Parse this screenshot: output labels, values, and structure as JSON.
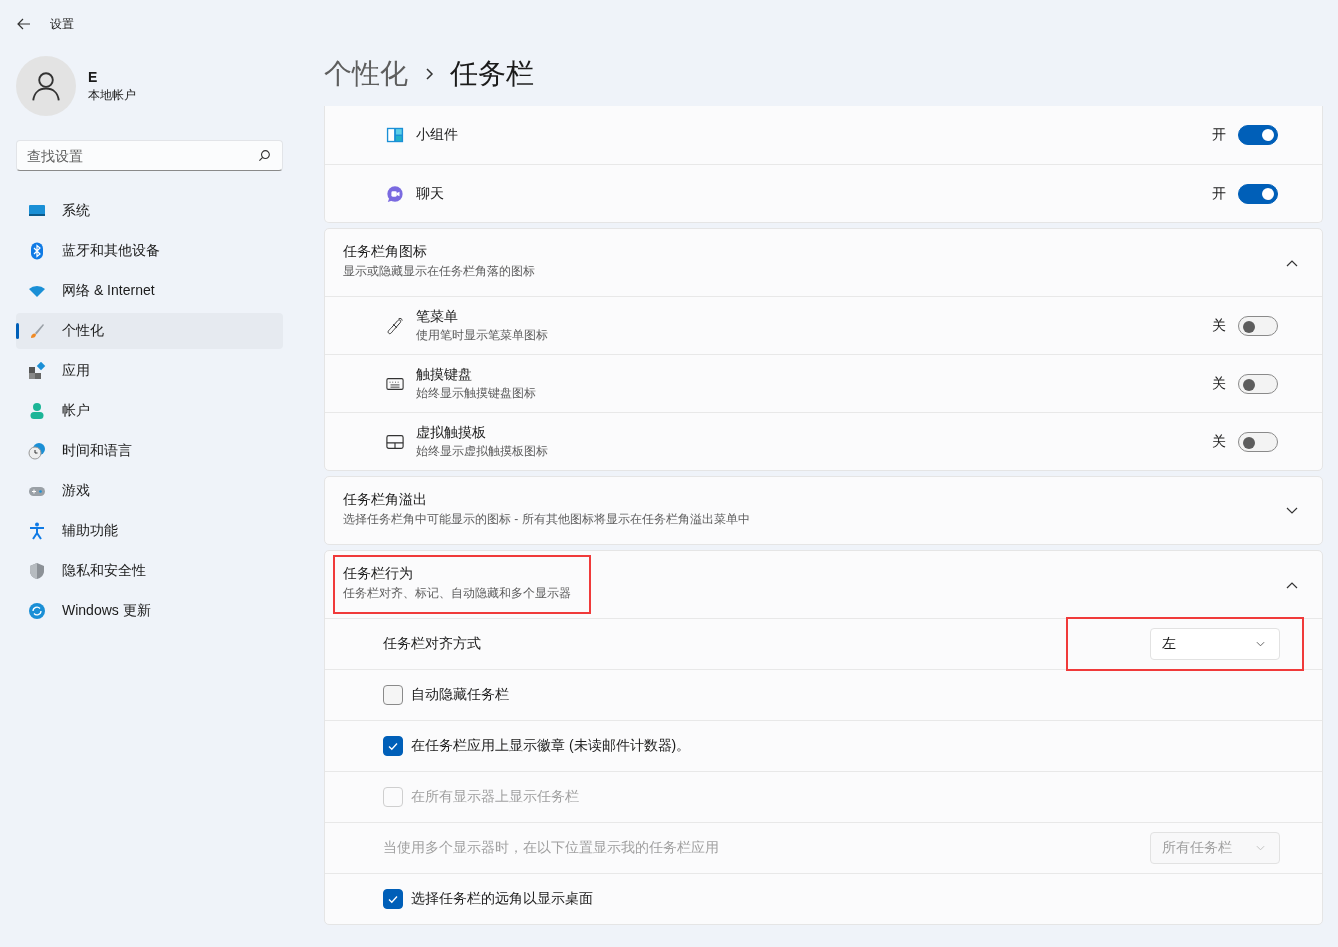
{
  "window": {
    "title": "设置"
  },
  "user": {
    "name": "E",
    "account": "本地帐户"
  },
  "search": {
    "placeholder": "查找设置"
  },
  "nav": [
    {
      "label": "系统",
      "selected": false
    },
    {
      "label": "蓝牙和其他设备",
      "selected": false
    },
    {
      "label": "网络 & Internet",
      "selected": false
    },
    {
      "label": "个性化",
      "selected": true
    },
    {
      "label": "应用",
      "selected": false
    },
    {
      "label": "帐户",
      "selected": false
    },
    {
      "label": "时间和语言",
      "selected": false
    },
    {
      "label": "游戏",
      "selected": false
    },
    {
      "label": "辅助功能",
      "selected": false
    },
    {
      "label": "隐私和安全性",
      "selected": false
    },
    {
      "label": "Windows 更新",
      "selected": false
    }
  ],
  "breadcrumb": [
    "个性化",
    "任务栏"
  ],
  "sections": [
    {
      "rows": [
        {
          "kind": "toggle",
          "label": "小组件",
          "state_text": "开",
          "on": true
        },
        {
          "kind": "toggle",
          "label": "聊天",
          "state_text": "开",
          "on": true
        }
      ]
    },
    {
      "header": {
        "title": "任务栏角图标",
        "description": "显示或隐藏显示在任务栏角落的图标",
        "expanded": true,
        "highlighted": false
      },
      "rows": [
        {
          "kind": "toggle",
          "label": "笔菜单",
          "description": "使用笔时显示笔菜单图标",
          "state_text": "关",
          "on": false
        },
        {
          "kind": "toggle",
          "label": "触摸键盘",
          "description": "始终显示触摸键盘图标",
          "state_text": "关",
          "on": false
        },
        {
          "kind": "toggle",
          "label": "虚拟触摸板",
          "description": "始终显示虚拟触摸板图标",
          "state_text": "关",
          "on": false
        }
      ]
    },
    {
      "header": {
        "title": "任务栏角溢出",
        "description": "选择任务栏角中可能显示的图标 - 所有其他图标将显示在任务栏角溢出菜单中",
        "expanded": false,
        "highlighted": false
      }
    },
    {
      "header": {
        "title": "任务栏行为",
        "description": "任务栏对齐、标记、自动隐藏和多个显示器",
        "expanded": true,
        "highlighted": true
      },
      "rows": [
        {
          "kind": "dropdown",
          "label": "任务栏对齐方式",
          "value": "左",
          "disabled": false,
          "highlighted": true
        },
        {
          "kind": "checkbox",
          "label": "自动隐藏任务栏",
          "checked": false,
          "disabled": false
        },
        {
          "kind": "checkbox",
          "label": "在任务栏应用上显示徽章 (未读邮件计数器)。",
          "checked": true,
          "disabled": false
        },
        {
          "kind": "checkbox",
          "label": "在所有显示器上显示任务栏",
          "checked": false,
          "disabled": true
        },
        {
          "kind": "dropdown",
          "label": "当使用多个显示器时，在以下位置显示我的任务栏应用",
          "value": "所有任务栏",
          "disabled": true,
          "highlighted": false
        },
        {
          "kind": "checkbox",
          "label": "选择任务栏的远角以显示桌面",
          "checked": true,
          "disabled": false
        }
      ]
    }
  ]
}
